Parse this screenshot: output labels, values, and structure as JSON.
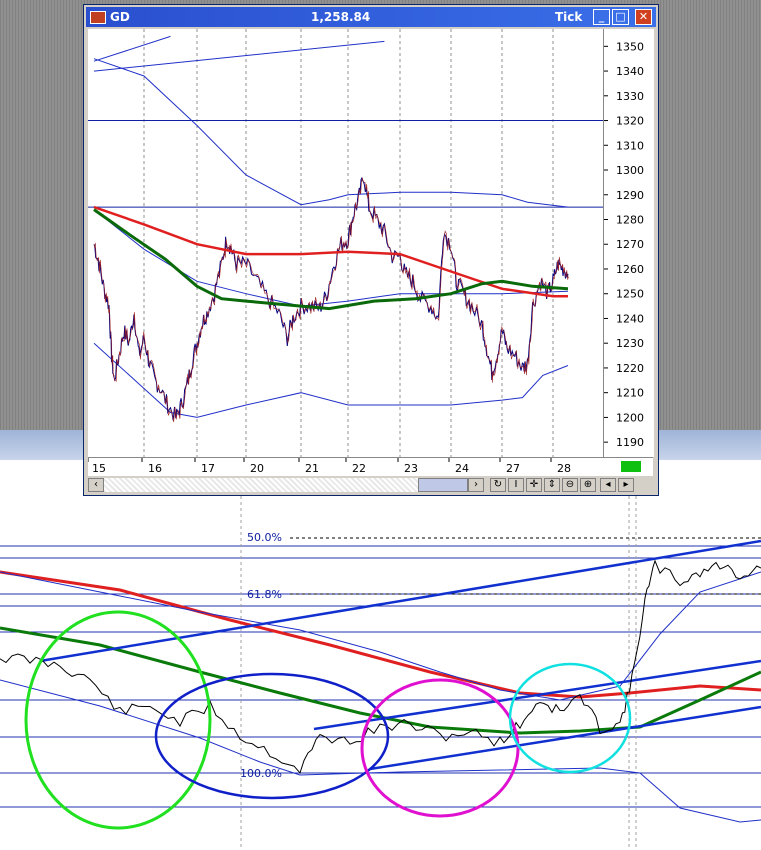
{
  "window": {
    "symbol": "GD",
    "price": "1,258.84",
    "mode": "Tick",
    "minimize": "_",
    "maximize": "□",
    "close": "✕"
  },
  "icons": [
    "chart-icon",
    "minimize-icon",
    "maximize-icon",
    "close-icon",
    "scroll-left-icon",
    "scroll-right-icon",
    "crosshair-icon",
    "pan-icon",
    "zoom-out-icon",
    "zoom-in-icon"
  ],
  "scroll_tools": [
    "‹",
    "›",
    "↻",
    "I",
    "✛",
    "⇕",
    "⊖",
    "⊕",
    "◂",
    "▸"
  ],
  "chart_data": [
    {
      "type": "line",
      "title": "",
      "y_ticks": [
        1190,
        1200,
        1210,
        1220,
        1230,
        1240,
        1250,
        1260,
        1270,
        1280,
        1290,
        1300,
        1310,
        1320,
        1330,
        1340,
        1350
      ],
      "ylim": [
        1184,
        1357
      ],
      "x_ticks": [
        "15",
        "16",
        "17",
        "20",
        "21",
        "22",
        "23",
        "24",
        "27",
        "28"
      ],
      "grid": "vertical dashed at day boundaries",
      "colors": {
        "price": "#000080",
        "ma_red": "#e02020",
        "ma_green": "#0a6a0a",
        "bands": "#2030c8",
        "hline": "#1020a0",
        "badge": "#10c010"
      },
      "hlines": [
        1320,
        1285
      ],
      "price": [
        [
          0,
          1270
        ],
        [
          0.1,
          1262
        ],
        [
          0.2,
          1252
        ],
        [
          0.3,
          1245
        ],
        [
          0.35,
          1225
        ],
        [
          0.4,
          1215
        ],
        [
          0.5,
          1225
        ],
        [
          0.6,
          1235
        ],
        [
          0.7,
          1230
        ],
        [
          0.8,
          1242
        ],
        [
          0.9,
          1225
        ],
        [
          1.0,
          1232
        ],
        [
          1.1,
          1222
        ],
        [
          1.2,
          1215
        ],
        [
          1.3,
          1212
        ],
        [
          1.45,
          1205
        ],
        [
          1.6,
          1200
        ],
        [
          1.7,
          1205
        ],
        [
          1.8,
          1212
        ],
        [
          1.9,
          1222
        ],
        [
          2.0,
          1230
        ],
        [
          2.1,
          1238
        ],
        [
          2.2,
          1242
        ],
        [
          2.35,
          1250
        ],
        [
          2.5,
          1262
        ],
        [
          2.6,
          1272
        ],
        [
          2.7,
          1268
        ],
        [
          2.8,
          1262
        ],
        [
          3.0,
          1262
        ],
        [
          3.2,
          1255
        ],
        [
          3.4,
          1248
        ],
        [
          3.6,
          1242
        ],
        [
          3.75,
          1232
        ],
        [
          3.85,
          1240
        ],
        [
          4.0,
          1245
        ],
        [
          4.2,
          1245
        ],
        [
          4.4,
          1244
        ],
        [
          4.55,
          1250
        ],
        [
          4.7,
          1262
        ],
        [
          4.85,
          1270
        ],
        [
          5.0,
          1272
        ],
        [
          5.1,
          1282
        ],
        [
          5.2,
          1288
        ],
        [
          5.3,
          1298
        ],
        [
          5.4,
          1285
        ],
        [
          5.55,
          1280
        ],
        [
          5.7,
          1275
        ],
        [
          5.85,
          1265
        ],
        [
          6.0,
          1265
        ],
        [
          6.1,
          1258
        ],
        [
          6.25,
          1255
        ],
        [
          6.4,
          1248
        ],
        [
          6.6,
          1245
        ],
        [
          6.75,
          1240
        ],
        [
          6.85,
          1275
        ],
        [
          7.0,
          1270
        ],
        [
          7.1,
          1255
        ],
        [
          7.25,
          1250
        ],
        [
          7.4,
          1245
        ],
        [
          7.6,
          1238
        ],
        [
          7.7,
          1228
        ],
        [
          7.8,
          1218
        ],
        [
          7.9,
          1225
        ],
        [
          8.0,
          1235
        ],
        [
          8.1,
          1228
        ],
        [
          8.25,
          1225
        ],
        [
          8.4,
          1220
        ],
        [
          8.5,
          1222
        ],
        [
          8.6,
          1245
        ],
        [
          8.75,
          1255
        ],
        [
          8.9,
          1250
        ],
        [
          9.0,
          1255
        ],
        [
          9.1,
          1262
        ],
        [
          9.2,
          1260
        ],
        [
          9.3,
          1258
        ]
      ],
      "ma_red": [
        [
          0,
          1285
        ],
        [
          1,
          1278
        ],
        [
          2,
          1270
        ],
        [
          3,
          1266
        ],
        [
          4,
          1266
        ],
        [
          5,
          1267
        ],
        [
          6,
          1266
        ],
        [
          7,
          1259
        ],
        [
          8,
          1252
        ],
        [
          9,
          1249
        ],
        [
          9.3,
          1249
        ]
      ],
      "ma_green": [
        [
          0,
          1284
        ],
        [
          0.7,
          1274
        ],
        [
          1.4,
          1264
        ],
        [
          2.0,
          1253
        ],
        [
          2.5,
          1248
        ],
        [
          3.0,
          1247
        ],
        [
          4.0,
          1245
        ],
        [
          4.6,
          1244
        ],
        [
          5.5,
          1247
        ],
        [
          6.3,
          1248
        ],
        [
          7.0,
          1250
        ],
        [
          7.6,
          1254
        ],
        [
          8.0,
          1255
        ],
        [
          8.6,
          1253
        ],
        [
          9.3,
          1252
        ]
      ],
      "upper_band": [
        [
          0,
          1345
        ],
        [
          1,
          1338
        ],
        [
          2,
          1318
        ],
        [
          3,
          1298
        ],
        [
          4,
          1286
        ],
        [
          4.6,
          1288
        ],
        [
          5,
          1290
        ],
        [
          6,
          1291
        ],
        [
          7,
          1291
        ],
        [
          8,
          1290
        ],
        [
          8.5,
          1287
        ],
        [
          9.3,
          1285
        ]
      ],
      "lower_band": [
        [
          0,
          1230
        ],
        [
          1.5,
          1202
        ],
        [
          2,
          1200
        ],
        [
          3,
          1205
        ],
        [
          4,
          1210
        ],
        [
          5,
          1205
        ],
        [
          6,
          1205
        ],
        [
          7,
          1205
        ],
        [
          8,
          1207
        ],
        [
          8.4,
          1208
        ],
        [
          8.8,
          1217
        ],
        [
          9.3,
          1221
        ]
      ],
      "mid_band": [
        [
          0,
          1284
        ],
        [
          1,
          1268
        ],
        [
          2,
          1255
        ],
        [
          3,
          1250
        ],
        [
          4,
          1245
        ],
        [
          5,
          1247
        ],
        [
          6,
          1250
        ],
        [
          7,
          1250
        ],
        [
          8,
          1250
        ],
        [
          9.3,
          1251
        ]
      ],
      "trendline": [
        [
          0,
          1344
        ],
        [
          1.5,
          1354
        ]
      ],
      "trendline2": [
        [
          0,
          1340
        ],
        [
          5.7,
          1352
        ]
      ]
    },
    {
      "type": "line",
      "title": "",
      "annotations": [
        "50.0%",
        "61.8%",
        "100.0%"
      ],
      "circles": [
        "green",
        "blue",
        "magenta",
        "cyan"
      ],
      "colors": {
        "price": "#000000",
        "ma_red": "#e02020",
        "ma_green": "#0a7a0a",
        "band": "#2030c8",
        "trend": "#1030d0",
        "green_circle": "#20e020",
        "blue_circle": "#1020c8",
        "magenta_circle": "#e010d0",
        "cyan_circle": "#10e0e0"
      }
    }
  ]
}
